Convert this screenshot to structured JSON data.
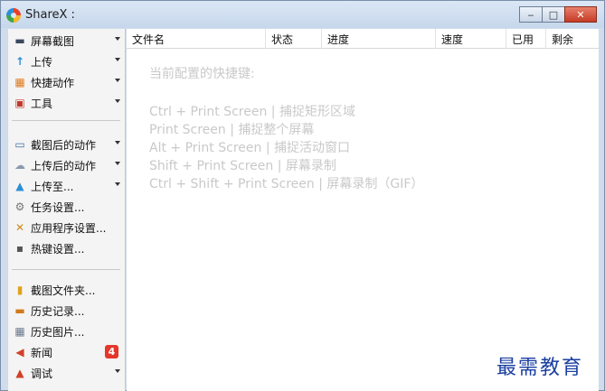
{
  "window": {
    "title": "ShareX :",
    "minimize_label": "‒",
    "maximize_label": "□",
    "close_label": "✕"
  },
  "sidebar": {
    "items": [
      {
        "label": "屏幕截图",
        "icon": "screenshot-icon",
        "glyph": "▬"
      },
      {
        "label": "上传",
        "icon": "upload-arrow-icon",
        "glyph": "↑"
      },
      {
        "label": "快捷动作",
        "icon": "grid-icon",
        "glyph": "▦"
      },
      {
        "label": "工具",
        "icon": "toolbox-icon",
        "glyph": "▣"
      },
      {
        "label": "截图后的动作",
        "icon": "after-capture-icon",
        "glyph": "▭"
      },
      {
        "label": "上传后的动作",
        "icon": "cloud-icon",
        "glyph": "☁"
      },
      {
        "label": "上传至...",
        "icon": "upload-destination-icon",
        "glyph": "▲"
      },
      {
        "label": "任务设置...",
        "icon": "gear-icon",
        "glyph": "⚙"
      },
      {
        "label": "应用程序设置...",
        "icon": "wrench-icon",
        "glyph": "✕"
      },
      {
        "label": "热键设置...",
        "icon": "keyboard-icon",
        "glyph": "▪"
      },
      {
        "label": "截图文件夹...",
        "icon": "folder-icon",
        "glyph": "▮"
      },
      {
        "label": "历史记录...",
        "icon": "history-icon",
        "glyph": "▬"
      },
      {
        "label": "历史图片...",
        "icon": "image-history-icon",
        "glyph": "▦"
      },
      {
        "label": "新闻",
        "icon": "megaphone-icon",
        "glyph": "◀",
        "badge": "4"
      },
      {
        "label": "调试",
        "icon": "debug-icon",
        "glyph": "▲"
      }
    ]
  },
  "table": {
    "columns": [
      "文件名",
      "状态",
      "进度",
      "速度",
      "已用",
      "剩余"
    ]
  },
  "hints": {
    "title": "当前配置的快捷键:",
    "lines": [
      "Ctrl + Print Screen  |  捕捉矩形区域",
      "Print Screen  |  捕捉整个屏幕",
      "Alt + Print Screen  |  捕捉活动窗口",
      "Shift + Print Screen  |  屏幕录制",
      "Ctrl + Shift + Print Screen  |  屏幕录制（GIF）"
    ]
  },
  "watermark": "最需教育",
  "colors": {
    "accent_blue": "#2b8fd6",
    "badge_red": "#e4372a",
    "hint_gray": "#c9c9c9",
    "watermark_blue": "#1a3fa0"
  }
}
